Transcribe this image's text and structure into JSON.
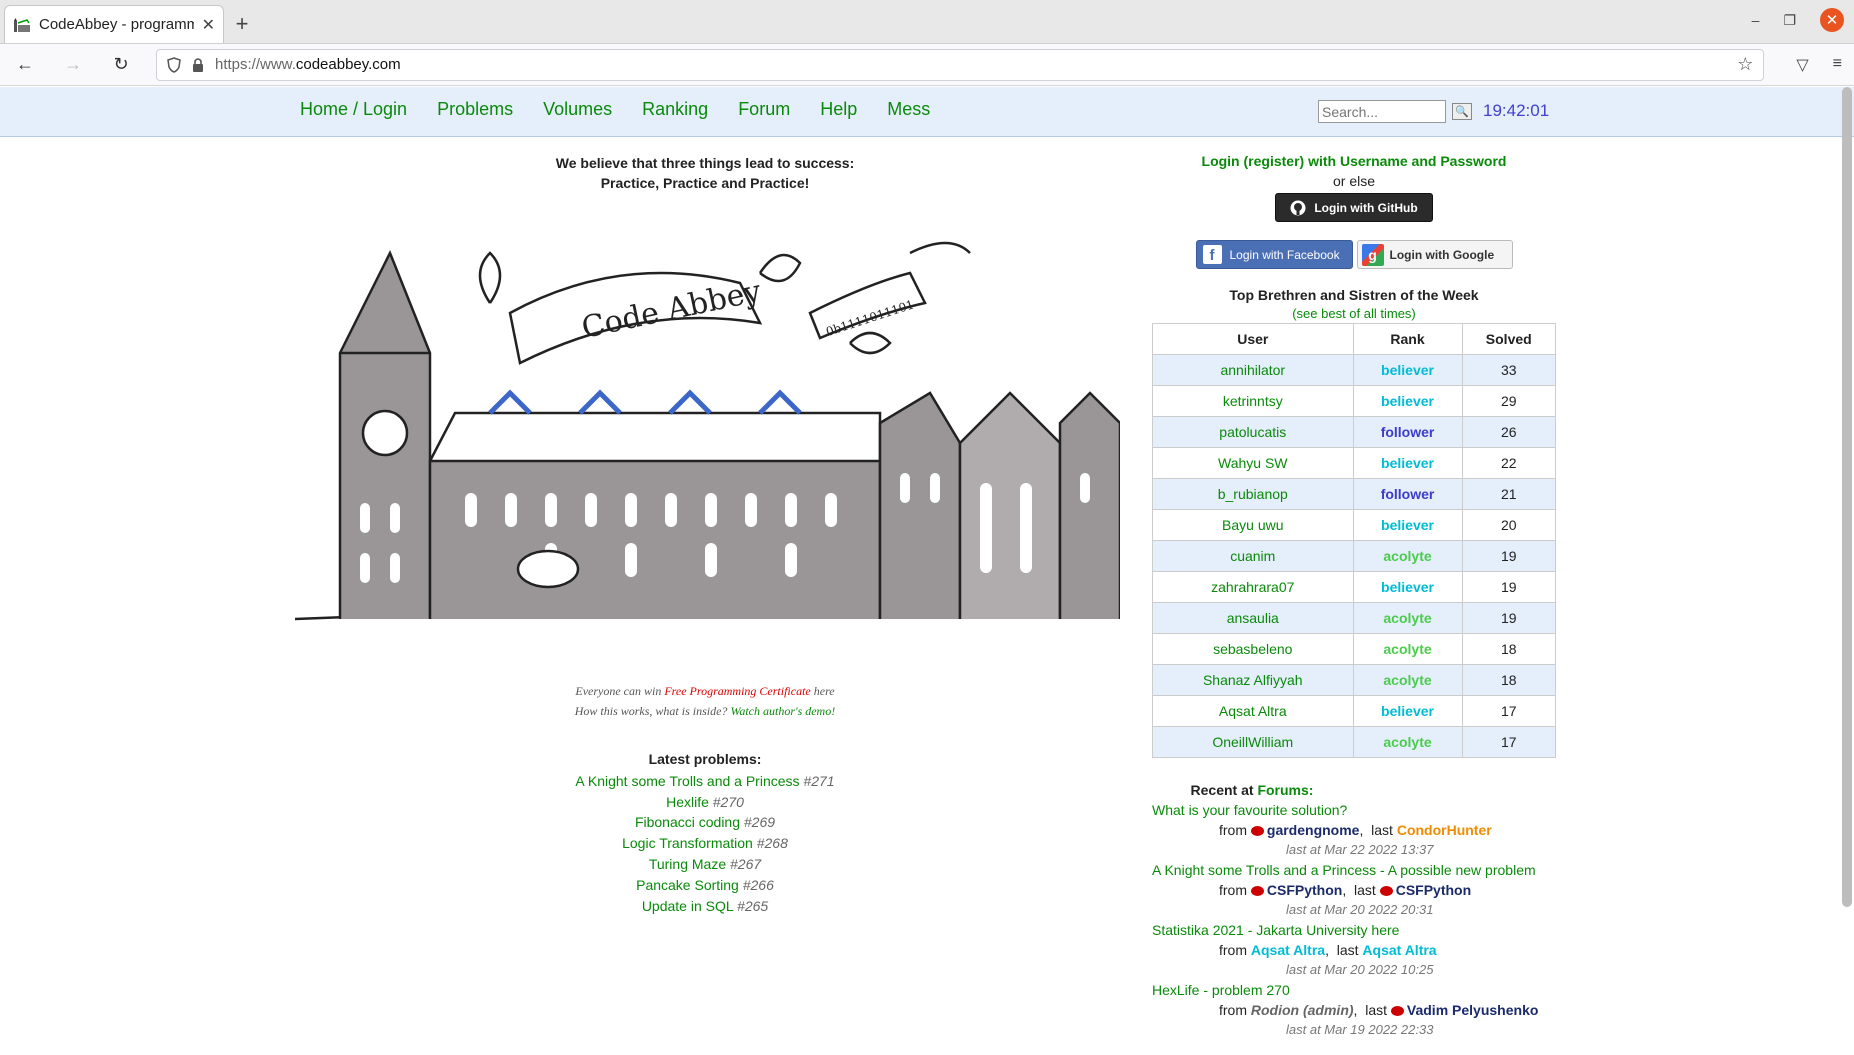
{
  "browser": {
    "tab_title": "CodeAbbey - programmin",
    "url_prefix": "https://www.",
    "url_domain": "codeabbey.com"
  },
  "menu": [
    "Home / Login",
    "Problems",
    "Volumes",
    "Ranking",
    "Forum",
    "Help",
    "Mess"
  ],
  "search": {
    "placeholder": "Search..."
  },
  "clock": "19:42:01",
  "motto": {
    "line1": "We believe that three things lead to success:",
    "line2": "Practice, Practice and Practice!"
  },
  "promo": {
    "line1_pre": "Everyone can win ",
    "line1_link": "Free Programming Certificate",
    "line1_post": " here",
    "line2_pre": "How this works, what is inside? ",
    "line2_link": "Watch author's demo!"
  },
  "latest": {
    "title": "Latest problems:",
    "items": [
      {
        "name": "A Knight some Trolls and a Princess",
        "num": "#271"
      },
      {
        "name": "Hexlife",
        "num": "#270"
      },
      {
        "name": "Fibonacci coding",
        "num": "#269"
      },
      {
        "name": "Logic Transformation",
        "num": "#268"
      },
      {
        "name": "Turing Maze",
        "num": "#267"
      },
      {
        "name": "Pancake Sorting",
        "num": "#266"
      },
      {
        "name": "Update in SQL",
        "num": "#265"
      }
    ]
  },
  "login": {
    "title": "Login (register) with Username and Password",
    "orelse": "or else",
    "github": "Login with GitHub",
    "facebook": "Login with Facebook",
    "google": "Login with Google"
  },
  "top": {
    "title": "Top Brethren and Sistren of the Week",
    "seebest": "(see best of all times)",
    "headers": [
      "User",
      "Rank",
      "Solved"
    ],
    "rows": [
      {
        "user": "annihilator",
        "rank": "believer",
        "solved": "33"
      },
      {
        "user": "ketrinntsy",
        "rank": "believer",
        "solved": "29"
      },
      {
        "user": "patolucatis",
        "rank": "follower",
        "solved": "26"
      },
      {
        "user": "Wahyu SW",
        "rank": "believer",
        "solved": "22"
      },
      {
        "user": "b_rubianop",
        "rank": "follower",
        "solved": "21"
      },
      {
        "user": "Bayu uwu",
        "rank": "believer",
        "solved": "20"
      },
      {
        "user": "cuanim",
        "rank": "acolyte",
        "solved": "19"
      },
      {
        "user": "zahrahrara07",
        "rank": "believer",
        "solved": "19"
      },
      {
        "user": "ansaulia",
        "rank": "acolyte",
        "solved": "19"
      },
      {
        "user": "sebasbeleno",
        "rank": "acolyte",
        "solved": "18"
      },
      {
        "user": "Shanaz Alfiyyah",
        "rank": "acolyte",
        "solved": "18"
      },
      {
        "user": "Aqsat Altra",
        "rank": "believer",
        "solved": "17"
      },
      {
        "user": "OneillWilliam",
        "rank": "acolyte",
        "solved": "17"
      }
    ]
  },
  "forums": {
    "head_pre": "Recent at ",
    "head_link": "Forums:",
    "from": "from",
    "last": "last",
    "topics": [
      {
        "title": "What is your favourite solution?",
        "from": "gardengnome",
        "last": "CondorHunter",
        "when": "last at Mar 22 2022 13:37"
      },
      {
        "title": "A Knight some Trolls and a Princess - A possible new problem",
        "from": "CSFPython",
        "last": "CSFPython",
        "when": "last at Mar 20 2022 20:31"
      },
      {
        "title": "Statistika 2021 - Jakarta University here",
        "from": "Aqsat Altra",
        "last": "Aqsat Altra",
        "when": "last at Mar 20 2022 10:25"
      },
      {
        "title": "HexLife - problem 270",
        "from": "Rodion (admin)",
        "last": "Vadim Pelyushenko",
        "when": "last at Mar 19 2022 22:33"
      }
    ]
  }
}
